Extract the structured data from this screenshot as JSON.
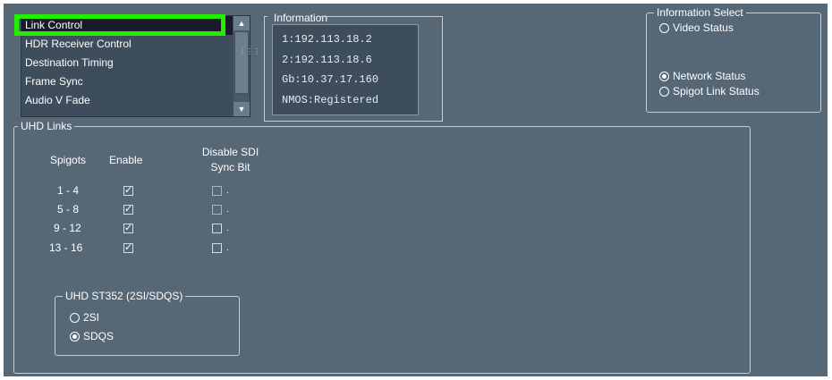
{
  "list": {
    "items": [
      "Link Control",
      "HDR Receiver Control",
      "Destination Timing",
      "Frame Sync",
      "Audio V Fade"
    ],
    "selected": "Link Control"
  },
  "information": {
    "title": "Information",
    "lines": [
      "1:192.113.18.2",
      "2:192.113.18.6",
      "Gb:10.37.17.160",
      "NMOS:Registered"
    ]
  },
  "information_select": {
    "title": "Information Select",
    "options": [
      {
        "label": "Video Status",
        "selected": false
      },
      {
        "label": "Network Status",
        "selected": true
      },
      {
        "label": "Spigot Link Status",
        "selected": false
      }
    ]
  },
  "uhd_links": {
    "title": "UHD Links",
    "headers": {
      "spigots": "Spigots",
      "enable": "Enable",
      "disable_sdi_line1": "Disable SDI",
      "disable_sdi_line2": "Sync Bit"
    },
    "rows": [
      {
        "spigots": "1 - 4",
        "enable": true,
        "disable_sync": false
      },
      {
        "spigots": "5 - 8",
        "enable": true,
        "disable_sync": false
      },
      {
        "spigots": "9 - 12",
        "enable": true,
        "disable_sync": false
      },
      {
        "spigots": "13 - 16",
        "enable": true,
        "disable_sync": false
      }
    ],
    "st352": {
      "title": "UHD ST352 (2SI/SDQS)",
      "options": [
        {
          "label": "2SI",
          "selected": false
        },
        {
          "label": "SDQS",
          "selected": true
        }
      ]
    }
  },
  "colors": {
    "panel": "#566776",
    "highlight": "#22ee00",
    "field": "#3d4d5b"
  },
  "icons": {
    "scroll_up": "triangle-up",
    "scroll_down": "triangle-down",
    "checked": "check-mark"
  }
}
